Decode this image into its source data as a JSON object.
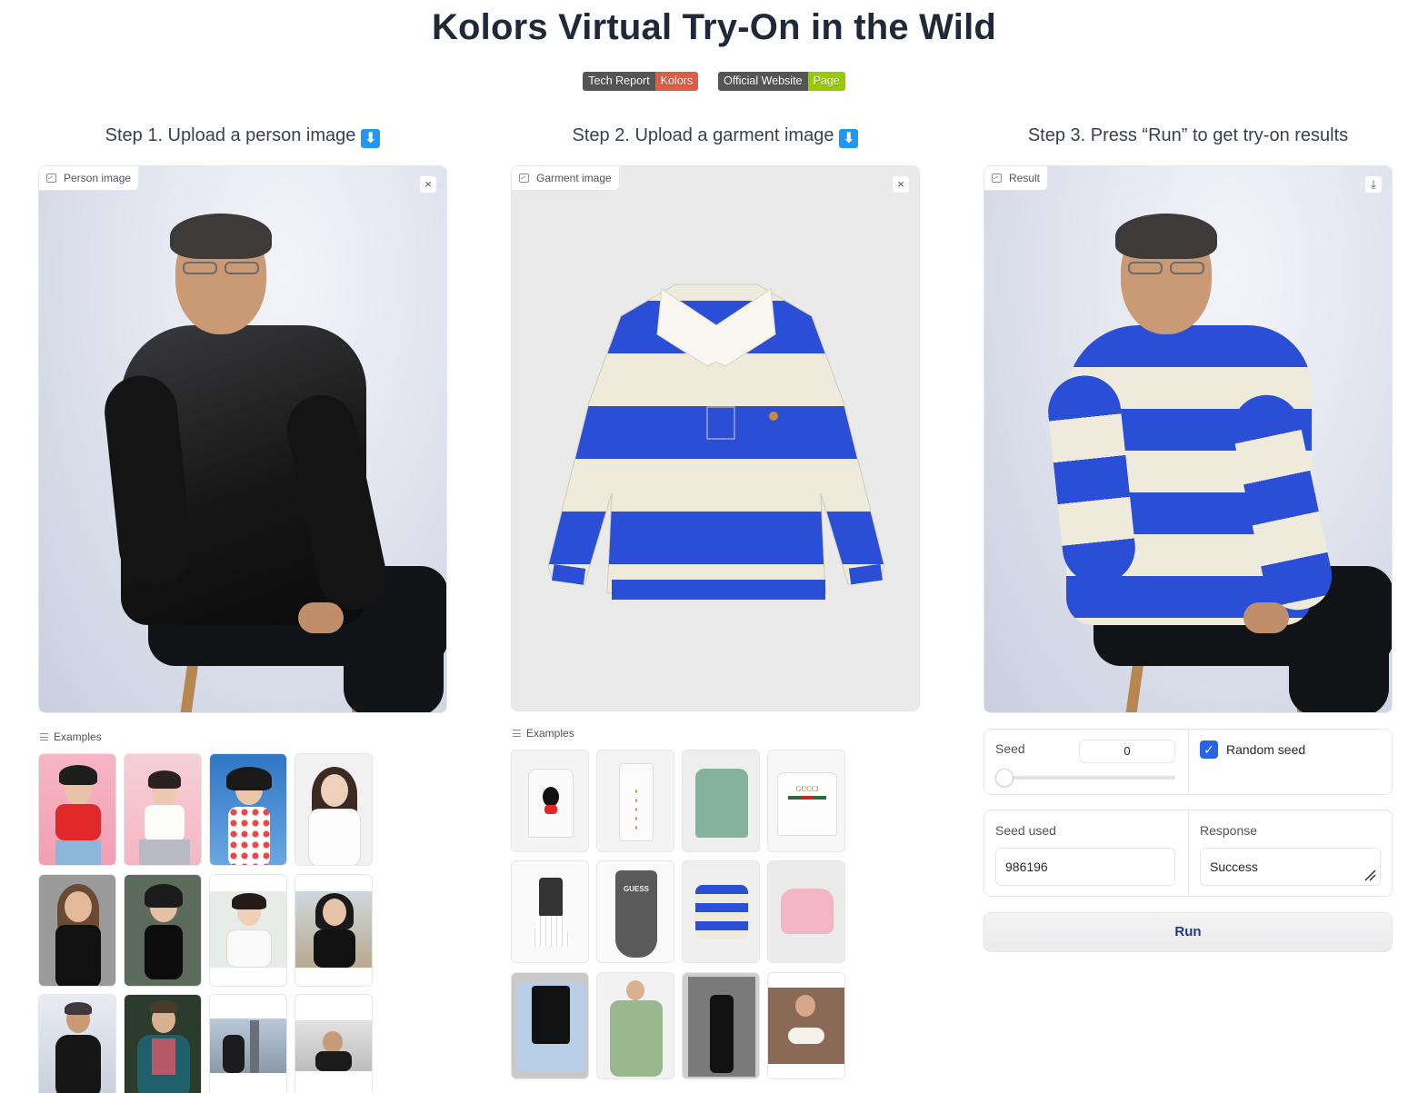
{
  "title": "Kolors Virtual Try-On in the Wild",
  "badges": [
    {
      "left": "Tech Report",
      "right": "Kolors",
      "color": "#e05d44"
    },
    {
      "left": "Official Website",
      "right": "Page",
      "color": "#97ca00"
    }
  ],
  "steps": {
    "step1": "Step 1. Upload a person image",
    "step2": "Step 2. Upload a garment image",
    "step3": "Step 3. Press “Run” to get try-on results",
    "arrow": "⬇"
  },
  "panels": {
    "person_label": "Person image",
    "garment_label": "Garment image",
    "result_label": "Result",
    "close_glyph": "×",
    "download_glyph": "⤓"
  },
  "examples_label": "Examples",
  "controls": {
    "seed_label": "Seed",
    "seed_value": "0",
    "seed_slider_fraction": 0,
    "random_seed_label": "Random seed",
    "random_seed_checked": true,
    "seed_used_label": "Seed used",
    "seed_used_value": "986196",
    "response_label": "Response",
    "response_value": "Success",
    "run_label": "Run"
  },
  "garment_examples_text": {
    "gucci": "GUCCI",
    "guess": "GUESS"
  },
  "colors": {
    "accent_blue": "#2563eb",
    "run_text": "#1e3a8a",
    "stripe_blue": "#2a4fd6",
    "stripe_cream": "#eeeadc"
  }
}
